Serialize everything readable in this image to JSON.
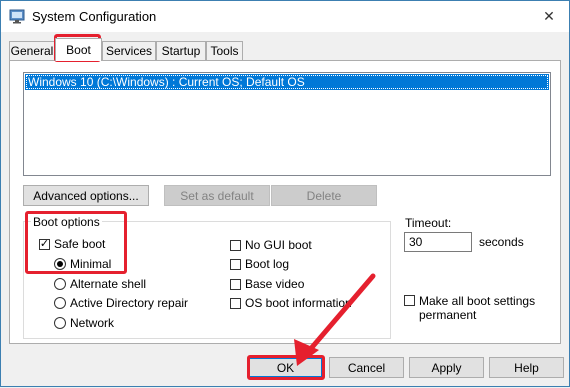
{
  "window": {
    "title": "System Configuration",
    "close_glyph": "✕"
  },
  "tabs": [
    {
      "label": "General"
    },
    {
      "label": "Boot"
    },
    {
      "label": "Services"
    },
    {
      "label": "Startup"
    },
    {
      "label": "Tools"
    }
  ],
  "os_list": {
    "items": [
      "Windows 10 (C:\\Windows) : Current OS; Default OS"
    ]
  },
  "os_buttons": {
    "advanced": "Advanced options...",
    "set_default": "Set as default",
    "delete": "Delete"
  },
  "boot_options": {
    "label": "Boot options",
    "safe_boot": {
      "label": "Safe boot",
      "checked": true
    },
    "modes": [
      {
        "label": "Minimal",
        "selected": true
      },
      {
        "label": "Alternate shell",
        "selected": false
      },
      {
        "label": "Active Directory repair",
        "selected": false
      },
      {
        "label": "Network",
        "selected": false
      }
    ],
    "flags": [
      {
        "label": "No GUI boot",
        "checked": false
      },
      {
        "label": "Boot log",
        "checked": false
      },
      {
        "label": "Base video",
        "checked": false
      },
      {
        "label": "OS boot information",
        "checked": false
      }
    ]
  },
  "timeout": {
    "label": "Timeout:",
    "value": "30",
    "unit": "seconds"
  },
  "permanent": {
    "label": "Make all boot settings permanent",
    "checked": false
  },
  "dialog_buttons": {
    "ok": "OK",
    "cancel": "Cancel",
    "apply": "Apply",
    "help": "Help"
  },
  "colors": {
    "highlight": "#e5202e",
    "selection": "#0078d7"
  }
}
